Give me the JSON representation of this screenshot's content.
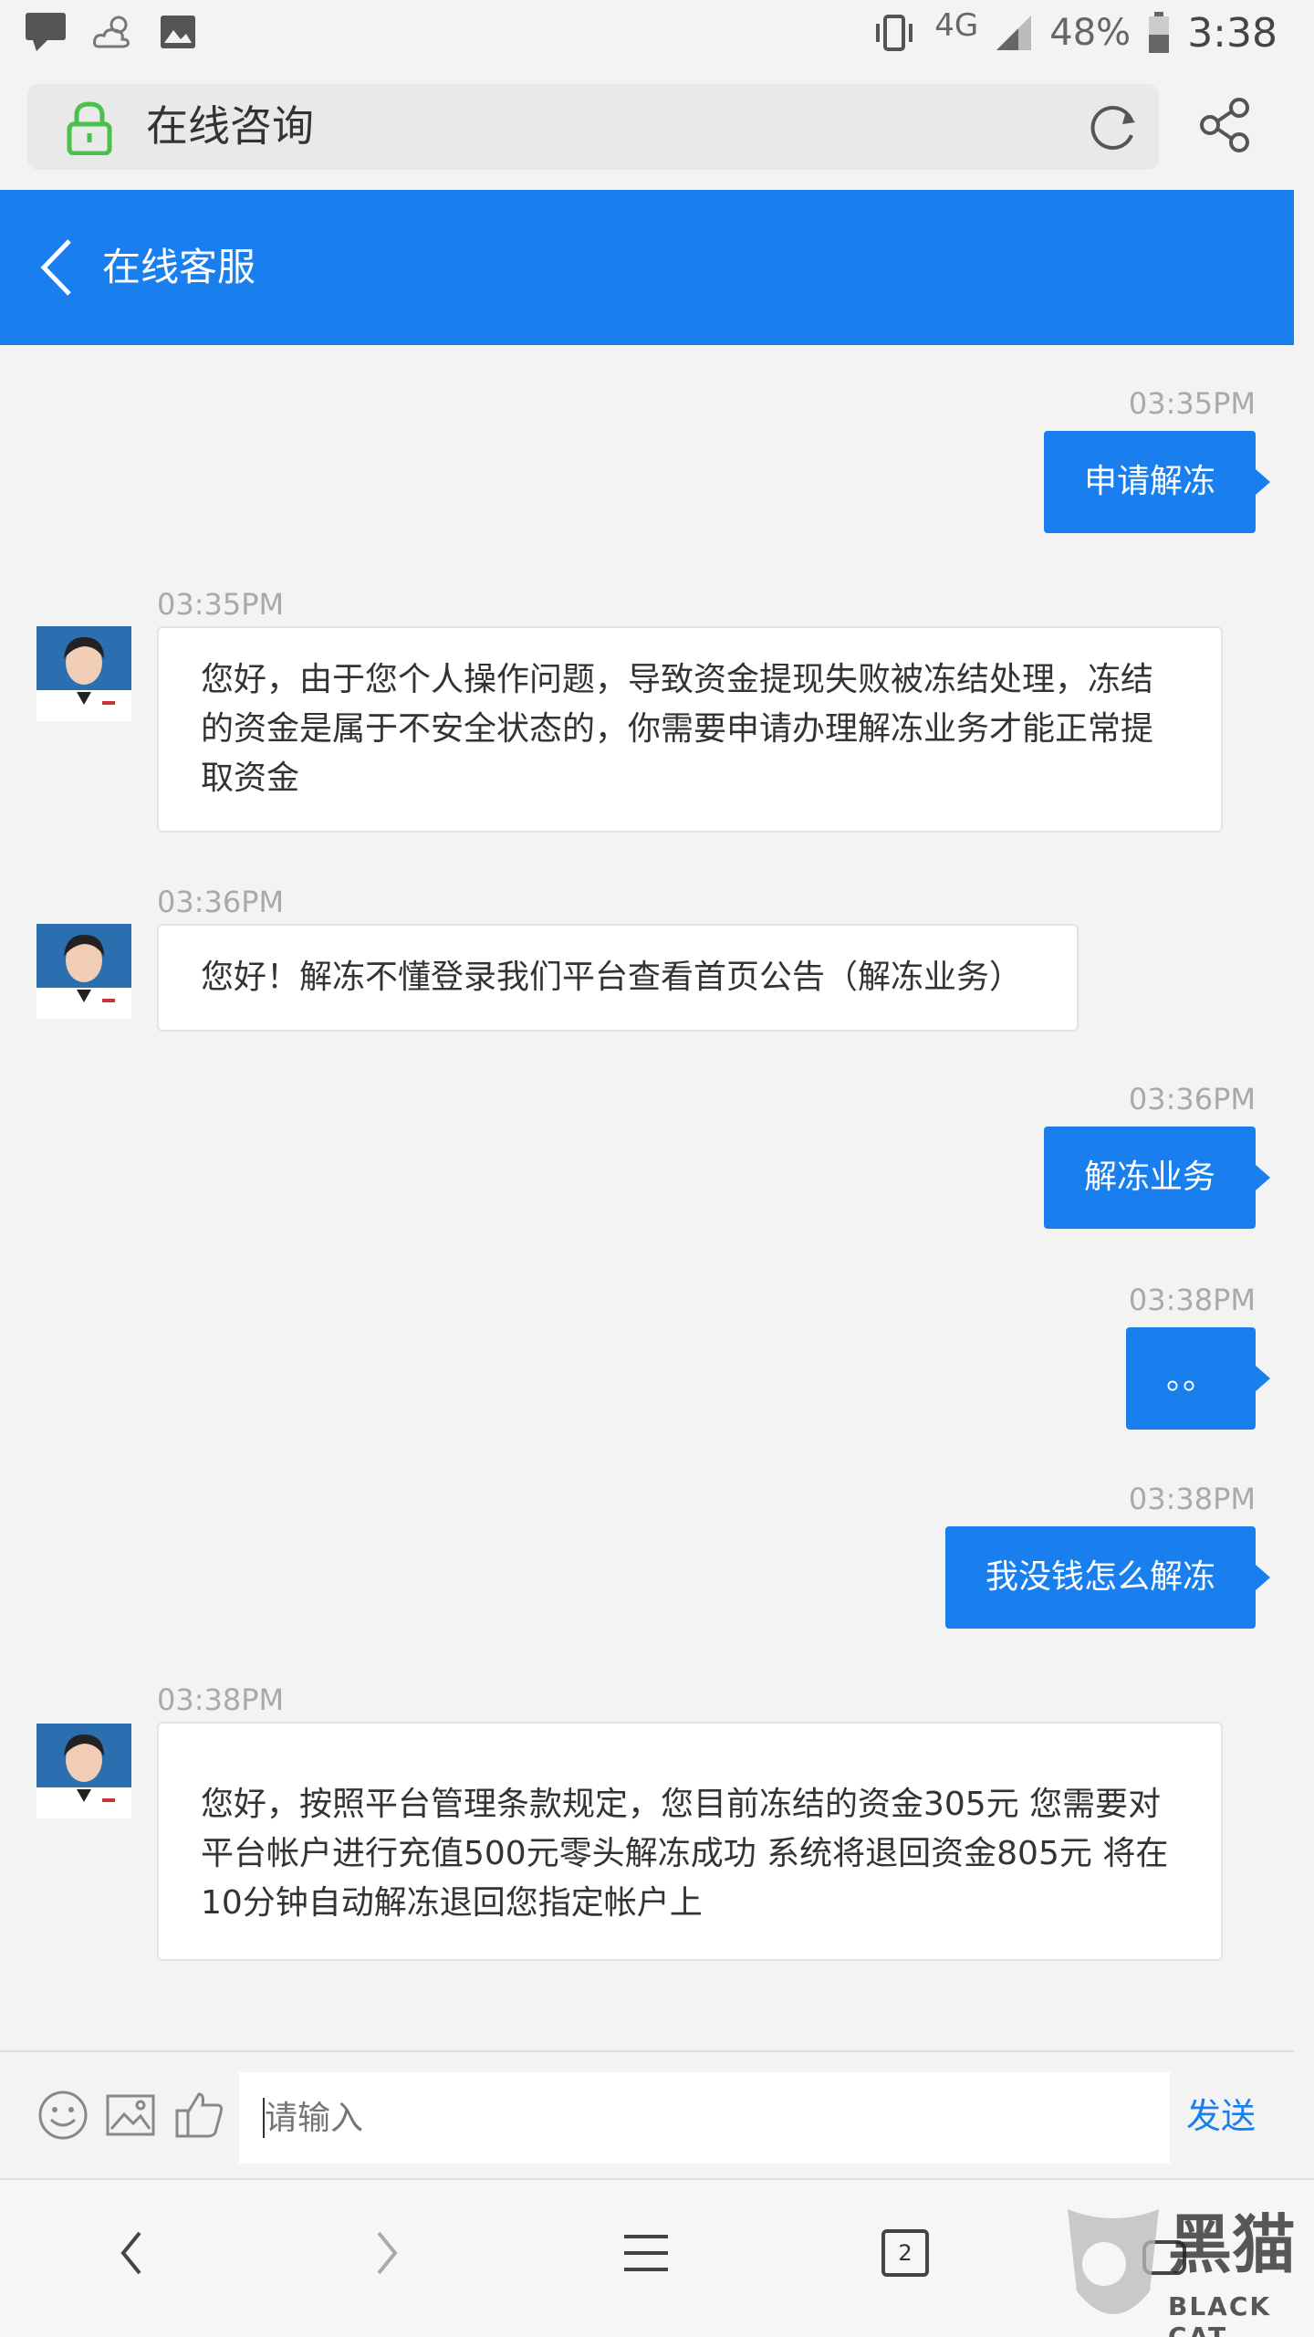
{
  "status_bar": {
    "network": "4G",
    "battery": "48%",
    "time": "3:38"
  },
  "browser": {
    "address_title": "在线咨询"
  },
  "header": {
    "title": "在线客服"
  },
  "messages": [
    {
      "side": "out",
      "time": "03:35PM",
      "text": "申请解冻"
    },
    {
      "side": "in",
      "time": "03:35PM",
      "lines": [
        "您好，由于您个人操作问题，导致资金提现失败被冻结处理，冻结",
        "的资金是属于不安全状态的，你需要申请办理解冻业务才能正常提",
        "取资金"
      ]
    },
    {
      "side": "in",
      "time": "03:36PM",
      "text": "您好！解冻不懂登录我们平台查看首页公告（解冻业务）"
    },
    {
      "side": "out",
      "time": "03:36PM",
      "text": "解冻业务"
    },
    {
      "side": "out",
      "time": "03:38PM",
      "text": "。。"
    },
    {
      "side": "out",
      "time": "03:38PM",
      "text": "我没钱怎么解冻"
    },
    {
      "side": "in",
      "time": "03:38PM",
      "lines": [
        "您好，按照平台管理条款规定，您目前冻结的资金305元 您需要对",
        "平台帐户进行充值500元零头解冻成功 系统将退回资金805元 将在",
        "10分钟自动解冻退回您指定帐户上"
      ]
    }
  ],
  "input": {
    "placeholder": "请输入",
    "send_label": "发送"
  },
  "nav": {
    "tabs_count": "2"
  },
  "watermark": {
    "text": "黑猫",
    "sub": "BLACK CAT"
  },
  "colors": {
    "accent": "#1a7fee",
    "bubble_in": "#ffffff",
    "background": "#f3f3f3"
  }
}
